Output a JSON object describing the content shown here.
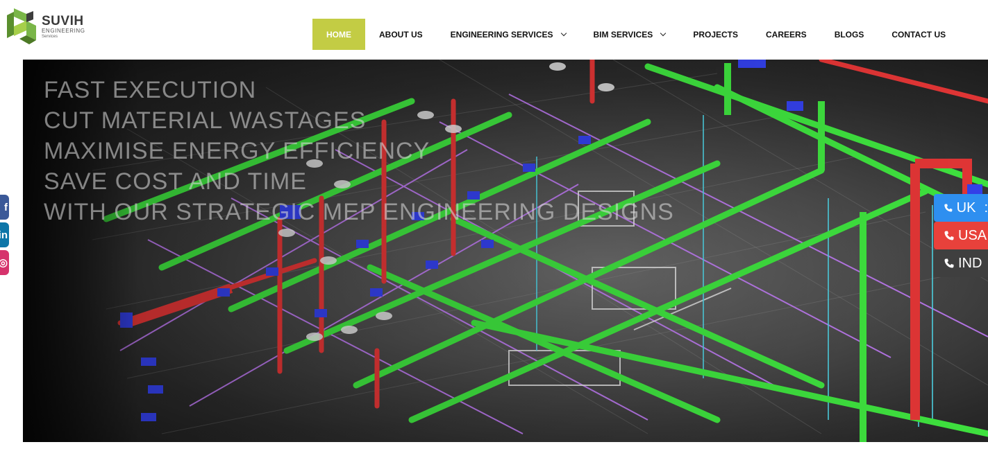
{
  "brand": {
    "name": "SUVIH",
    "sub1": "ENGINEERING",
    "sub2": "Services",
    "colors": {
      "green": "#7ab648",
      "dark": "#3a3a3a"
    }
  },
  "nav": {
    "active_color": "#c3cc44",
    "items": [
      {
        "label": "HOME",
        "active": true
      },
      {
        "label": "ABOUT US"
      },
      {
        "label": "ENGINEERING SERVICES",
        "dropdown": true
      },
      {
        "label": "BIM SERVICES",
        "dropdown": true
      },
      {
        "label": "PROJECTS"
      },
      {
        "label": "CAREERS"
      },
      {
        "label": "BLOGS"
      },
      {
        "label": "CONTACT US"
      }
    ]
  },
  "hero": {
    "lines": [
      "FAST EXECUTION",
      "CUT MATERIAL WASTAGES",
      "MAXIMISE ENERGY EFFICIENCY",
      "SAVE COST AND TIME",
      "WITH OUR STRATEGIC MEP ENGINEERING DESIGNS"
    ],
    "image": "3d-mep-bim-model"
  },
  "social": {
    "facebook": {
      "glyph": "f",
      "icon": "facebook-icon",
      "color": "#3b5998"
    },
    "linkedin": {
      "glyph": "in",
      "icon": "linkedin-icon",
      "color": "#0e76a8"
    },
    "instagram": {
      "glyph": "◎",
      "icon": "instagram-icon",
      "color": "#d6336c"
    }
  },
  "phones": {
    "uk": {
      "label": "UK",
      "suffix": ":",
      "color": "#2e8ff0",
      "icon": "phone-icon"
    },
    "usa": {
      "label": "USA",
      "color": "#e8413b",
      "icon": "phone-icon"
    },
    "ind": {
      "label": "IND",
      "color": "#3f3f3f",
      "icon": "phone-icon"
    }
  }
}
